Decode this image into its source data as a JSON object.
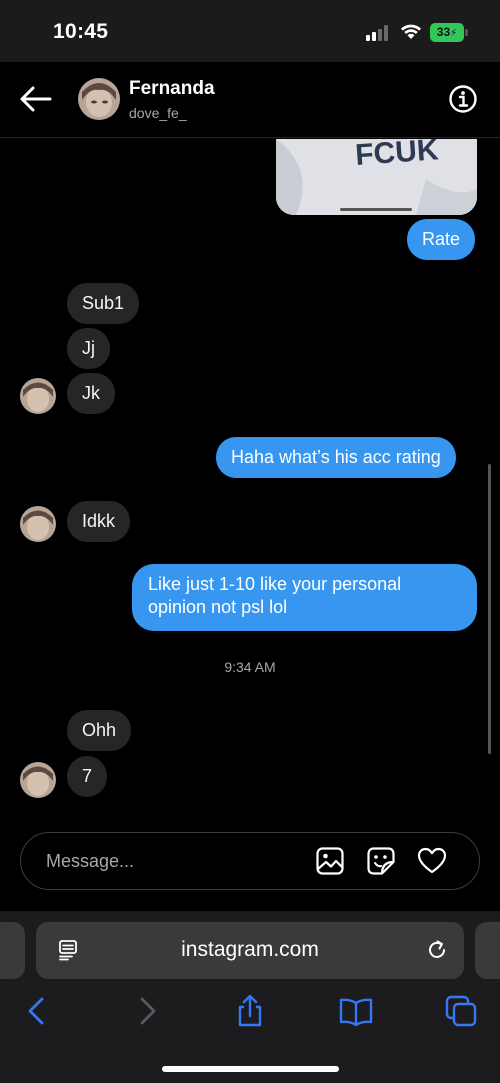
{
  "status_bar": {
    "time": "10:45",
    "battery": "33",
    "icons": [
      "cellular-signal-icon",
      "wifi-icon",
      "battery-charging-icon"
    ]
  },
  "header": {
    "name": "Fernanda",
    "username": "dove_fe_",
    "icons": [
      "back-arrow-icon",
      "info-icon"
    ]
  },
  "shared_image": {
    "visible_text": "FCUK"
  },
  "messages": [
    {
      "direction": "out",
      "text": "Rate"
    },
    {
      "direction": "in",
      "text": "Sub1"
    },
    {
      "direction": "in",
      "text": "Jj"
    },
    {
      "direction": "in",
      "text": "Jk"
    },
    {
      "direction": "out",
      "text": "Haha what’s his acc rating"
    },
    {
      "direction": "in",
      "text": "Idkk"
    },
    {
      "direction": "out",
      "text": "Like just 1-10 like your personal opinion not psl lol",
      "lines": [
        "Like just 1-10 like your personal",
        "opinion not psl lol"
      ]
    },
    {
      "direction": "in",
      "text": "Ohh"
    },
    {
      "direction": "in",
      "text": "7"
    }
  ],
  "timestamp": "9:34 AM",
  "composer": {
    "placeholder": "Message...",
    "icons": [
      "gallery-icon",
      "sticker-icon",
      "heart-icon"
    ]
  },
  "browser": {
    "url": "instagram.com",
    "icons": [
      "reader-mode-icon",
      "reload-icon",
      "back-chevron-icon",
      "forward-chevron-icon",
      "share-icon",
      "bookmarks-icon",
      "tabs-icon"
    ],
    "accent_color": "#3478f6"
  },
  "colors": {
    "outgoing_bubble": "#3797f0",
    "incoming_bubble": "#262626",
    "battery": "#32c759"
  }
}
